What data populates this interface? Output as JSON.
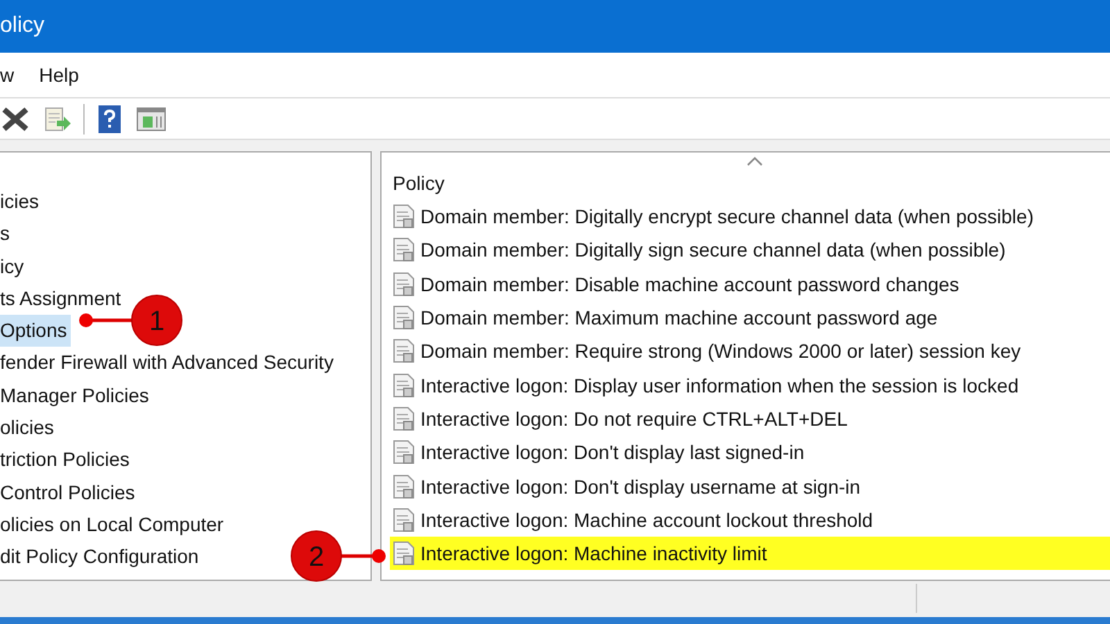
{
  "window": {
    "title": "olicy"
  },
  "menu": [
    "w",
    "Help"
  ],
  "tree": [
    {
      "label": "icies",
      "selected": false
    },
    {
      "label": "s",
      "selected": false
    },
    {
      "label": "icy",
      "selected": false
    },
    {
      "label": "ts Assignment",
      "selected": false
    },
    {
      "label": "Options",
      "selected": true
    },
    {
      "label": "fender Firewall with Advanced Security",
      "selected": false
    },
    {
      "label": "Manager Policies",
      "selected": false
    },
    {
      "label": "olicies",
      "selected": false
    },
    {
      "label": "triction Policies",
      "selected": false
    },
    {
      "label": "Control Policies",
      "selected": false
    },
    {
      "label": "olicies on Local Computer",
      "selected": false
    },
    {
      "label": "dit Policy Configuration",
      "selected": false
    }
  ],
  "list": {
    "columns": [
      "Policy"
    ],
    "rows": [
      {
        "policy": "Domain member: Digitally encrypt secure channel data (when possible)",
        "highlighted": false
      },
      {
        "policy": "Domain member: Digitally sign secure channel data (when possible)",
        "highlighted": false
      },
      {
        "policy": "Domain member: Disable machine account password changes",
        "highlighted": false
      },
      {
        "policy": "Domain member: Maximum machine account password age",
        "highlighted": false
      },
      {
        "policy": "Domain member: Require strong (Windows 2000 or later) session key",
        "highlighted": false
      },
      {
        "policy": "Interactive logon: Display user information when the session is locked",
        "highlighted": false
      },
      {
        "policy": "Interactive logon: Do not require CTRL+ALT+DEL",
        "highlighted": false
      },
      {
        "policy": "Interactive logon: Don't display last signed-in",
        "highlighted": false
      },
      {
        "policy": "Interactive logon: Don't display username at sign-in",
        "highlighted": false
      },
      {
        "policy": "Interactive logon: Machine account lockout threshold",
        "highlighted": false
      },
      {
        "policy": "Interactive logon: Machine inactivity limit",
        "highlighted": true
      }
    ]
  },
  "callouts": [
    {
      "number": "1"
    },
    {
      "number": "2"
    }
  ]
}
